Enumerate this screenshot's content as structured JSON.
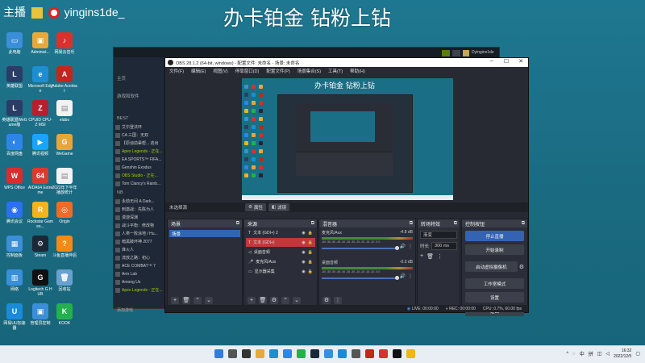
{
  "overlay": {
    "left_text": "主播",
    "username": "yingins1de_",
    "title": "办卡铂金 钻粉上钻"
  },
  "desktop_icons": [
    {
      "label": "此电脑",
      "color": "#3b8fd9",
      "glyph": "▭"
    },
    {
      "label": "Administ...",
      "color": "#e7a93a",
      "glyph": "▣"
    },
    {
      "label": "网易云音乐",
      "color": "#d8322f",
      "glyph": "♪"
    },
    {
      "label": "英雄联盟",
      "color": "#2a3d66",
      "glyph": "L"
    },
    {
      "label": "Microsoft Edge",
      "color": "#1b8fd2",
      "glyph": "e"
    },
    {
      "label": "Adobe Acrobat",
      "color": "#c2261f",
      "glyph": "A"
    },
    {
      "label": "英雄联盟WeGame版",
      "color": "#2a3d66",
      "glyph": "L"
    },
    {
      "label": "CPUID CPU-Z MSI",
      "color": "#b51f2e",
      "glyph": "Z"
    },
    {
      "label": "elabo",
      "color": "#f2f2f2",
      "glyph": "▤"
    },
    {
      "label": "百度网盘",
      "color": "#2e85e8",
      "glyph": "◐"
    },
    {
      "label": "腾讯视频",
      "color": "#1aa3ff",
      "glyph": "▶"
    },
    {
      "label": "WeGame",
      "color": "#e8a53a",
      "glyph": "G"
    },
    {
      "label": "WPS Office",
      "color": "#d72d2d",
      "glyph": "W"
    },
    {
      "label": "AIDA64 Extreme",
      "color": "#d93b2c",
      "glyph": "64"
    },
    {
      "label": "2022年下半年播放统计",
      "color": "#f2f2f2",
      "glyph": "▤"
    },
    {
      "label": "腾讯会议",
      "color": "#2b6ff2",
      "glyph": "◉"
    },
    {
      "label": "Rockstar Games...",
      "color": "#f3b31a",
      "glyph": "R"
    },
    {
      "label": "Origin",
      "color": "#f06a28",
      "glyph": "◎"
    },
    {
      "label": "控制面板",
      "color": "#3b8fd9",
      "glyph": "▦"
    },
    {
      "label": "Steam",
      "color": "#1b2838",
      "glyph": "⚙"
    },
    {
      "label": "斗鱼直播伴侣",
      "color": "#f28a1a",
      "glyph": "?"
    },
    {
      "label": "网络",
      "color": "#3b8fd9",
      "glyph": "▥"
    },
    {
      "label": "Logitech G HUB",
      "color": "#111111",
      "glyph": "G"
    },
    {
      "label": "回收站",
      "color": "#6aa0cf",
      "glyph": "🗑"
    },
    {
      "label": "网易UU加速器",
      "color": "#1a8bd8",
      "glyph": "U"
    },
    {
      "label": "管理员控制",
      "color": "#3b8fd9",
      "glyph": "▣"
    },
    {
      "label": "KOOK",
      "color": "#22b14c",
      "glyph": "K"
    }
  ],
  "steam": {
    "nav": "← →",
    "shop_title": "商店",
    "home": "主页",
    "games_label": "游戏和软件",
    "best_label": "BEST",
    "items": [
      "艾尔登法环",
      "CA 三国：无双",
      "【原谅前辈帮... 逃出",
      "Apex Legends - 正在...",
      "EA SPORTS™ FIFA...",
      "Genshin Exodus",
      "OBS Studio - 正在...",
      "Tom Clancy's Rainb..."
    ],
    "nb_label": "NB",
    "items2": [
      "永劫无间 A Dark...",
      "刺激战：先陈为人",
      "漫游深渊",
      "战斗平衡：修改物",
      "人类一败涂地 / Hu...",
      "暗黑破坏神 2077",
      "烽火人",
      "流放之路：初心",
      "ACE COMBAT™ 7",
      "Arm Lab",
      "Among Us",
      "Apex Legends - 正在..."
    ],
    "add_game": "添加游戏",
    "account": "Dyingins1de"
  },
  "obs": {
    "title": "OBS 28.1.2 (64-bit, windows) - 配置文件: 未命名 - 场景: 未命名",
    "menu": [
      "文件(F)",
      "编辑(E)",
      "视图(V)",
      "停靠窗口(D)",
      "配置文件(P)",
      "场景集合(S)",
      "工具(T)",
      "帮助(H)"
    ],
    "preview_title": "办卡铂金 钻粉上钻",
    "no_source": "未选择源",
    "props_btn": "属性",
    "filters_btn": "滤镜",
    "docks": {
      "scenes": {
        "title": "场景",
        "items": [
          "场景"
        ]
      },
      "sources": {
        "title": "来源",
        "items": [
          {
            "name": "文本 (GDI+) 2",
            "selected": false
          },
          {
            "name": "文本 (GDI+)",
            "selected": true
          },
          {
            "name": "桌面音频",
            "selected": false
          },
          {
            "name": "麦克风/Aux",
            "selected": false
          },
          {
            "name": "显示器采集",
            "selected": false
          }
        ]
      },
      "mixer": {
        "title": "混音器",
        "channels": [
          {
            "name": "麦克风/Aux",
            "db": "-4.8 dB",
            "scale": "-60 -55 -50 -45 -40 -35 -30 -25 -20 -15 -10 -5 0"
          },
          {
            "name": "桌面音频",
            "db": "-0.0 dB",
            "scale": "-60 -55 -50 -45 -40 -35 -30 -25 -20 -15 -10 -5 0"
          }
        ]
      },
      "transitions": {
        "title": "转场特效",
        "type": "渐变",
        "duration_label": "时长",
        "duration_value": "300 ms"
      },
      "controls": {
        "title": "控制按钮",
        "buttons": [
          "停止直播",
          "开始录制",
          "启动虚拟摄像机",
          "工作室模式",
          "设置",
          "退出"
        ]
      }
    },
    "status": {
      "live": "LIVE: 00:00:00",
      "rec": "REC: 00:00:00",
      "cpu": "CPU: 0.7%, 60.00 fps"
    }
  },
  "taskbar": {
    "time": "16:32",
    "date": "2022/12/5",
    "lang": "中",
    "status": "拼"
  }
}
